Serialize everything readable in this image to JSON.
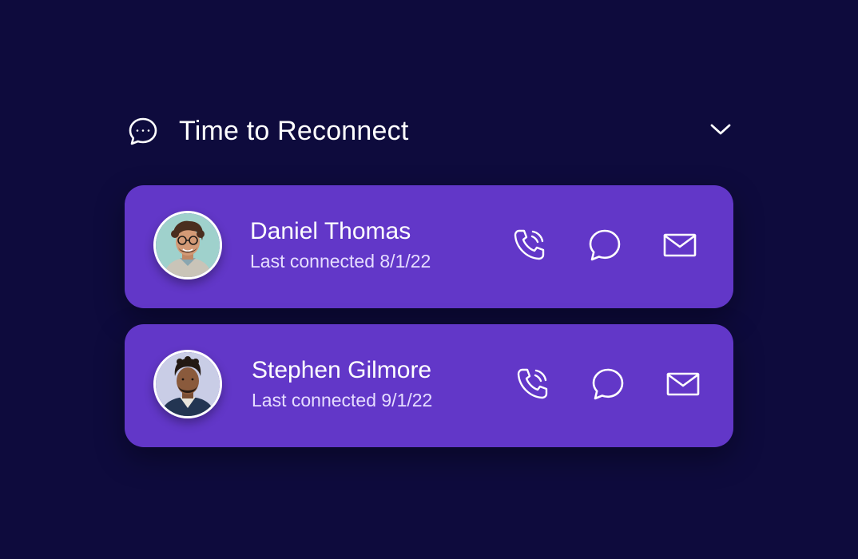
{
  "widget": {
    "title": "Time to Reconnect",
    "header_icon": "chat-dots-icon",
    "collapse_icon": "chevron-down-icon"
  },
  "contacts": [
    {
      "name": "Daniel Thomas",
      "last_connected": "Last connected 8/1/22",
      "avatar": "avatar-daniel-thomas"
    },
    {
      "name": "Stephen Gilmore",
      "last_connected": "Last connected 9/1/22",
      "avatar": "avatar-stephen-gilmore"
    }
  ],
  "actions": {
    "call_icon": "phone-call-icon",
    "message_icon": "chat-bubble-icon",
    "email_icon": "mail-icon"
  },
  "colors": {
    "background": "#0e0b3d",
    "card": "#6237c8",
    "text": "#ffffff"
  }
}
